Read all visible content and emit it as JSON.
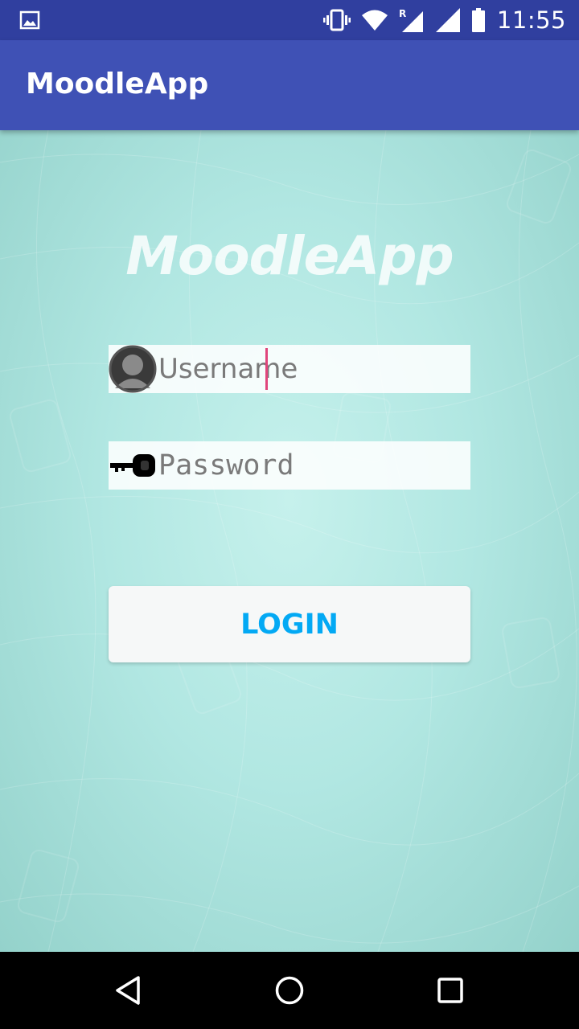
{
  "status_bar": {
    "time": "11:55",
    "icons": [
      "image-notification-icon",
      "vibrate-icon",
      "wifi-icon",
      "roaming-signal-icon",
      "signal-icon",
      "battery-icon"
    ]
  },
  "app_bar": {
    "title": "MoodleApp"
  },
  "login": {
    "hero_title": "MoodleApp",
    "username_placeholder": "Username",
    "password_placeholder": "Password",
    "login_label": "LOGIN"
  },
  "nav_bar": {
    "buttons": [
      "back-icon",
      "home-icon",
      "recents-icon"
    ]
  },
  "colors": {
    "status_bar": "#303f9f",
    "app_bar": "#3f51b5",
    "accent": "#03a9f4",
    "caret": "#e0467c",
    "background": "#b1e7e2"
  }
}
